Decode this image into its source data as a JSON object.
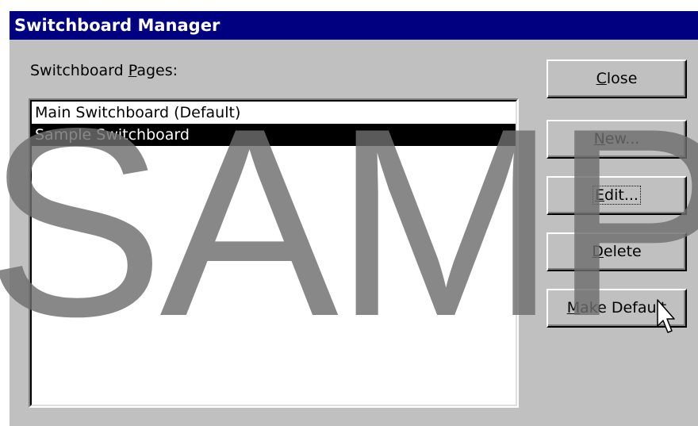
{
  "window": {
    "title": "Switchboard Manager"
  },
  "pages_label": {
    "prefix": "Switchboard ",
    "mnemonic": "P",
    "suffix": "ages:"
  },
  "list": {
    "items": [
      {
        "label": "Main Switchboard (Default)",
        "selected": false
      },
      {
        "label": "Sample Switchboard",
        "selected": true
      }
    ]
  },
  "buttons": {
    "close": {
      "mnemonic": "C",
      "rest": "lose"
    },
    "new": {
      "mnemonic": "N",
      "rest": "ew..."
    },
    "edit": {
      "mnemonic": "E",
      "rest": "dit..."
    },
    "delete": {
      "mnemonic": "D",
      "rest": "elete"
    },
    "make_default": {
      "mnemonic": "M",
      "rest": "ake Default"
    }
  },
  "watermark": {
    "text": "SAMPLE"
  },
  "colors": {
    "titlebar": "#000080",
    "dialog_face": "#c0c0c0",
    "selection": "#000000"
  },
  "icons": {
    "cursor": "arrow-pointer-icon"
  }
}
